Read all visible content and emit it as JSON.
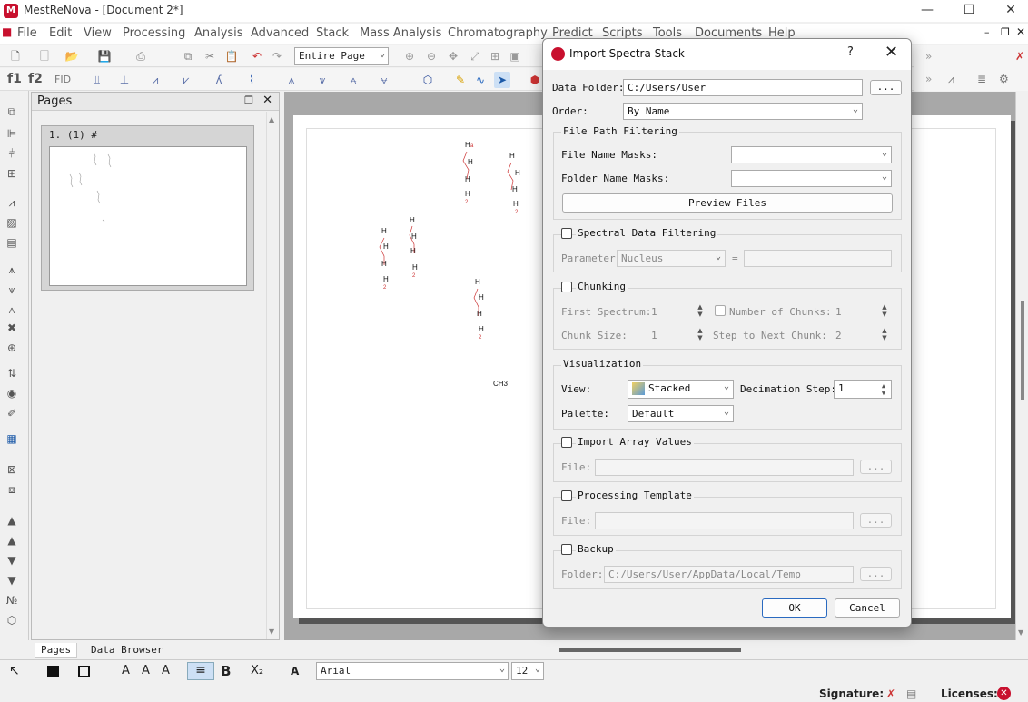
{
  "window": {
    "title": "MestReNova - [Document 2*]",
    "minimize": "—",
    "maximize": "☐",
    "close": "✕"
  },
  "menu": [
    "File",
    "Edit",
    "View",
    "Processing",
    "Analysis",
    "Advanced",
    "Stack",
    "Mass Analysis",
    "Chromatography",
    "Predict",
    "Scripts",
    "Tools",
    "Documents",
    "Help"
  ],
  "toolbar": {
    "page_mode": "Entire Page",
    "f1": "f1",
    "f2": "f2",
    "fid": "FID"
  },
  "pages_panel": {
    "title": "Pages",
    "item_label": "1.  (1)  #"
  },
  "bottom_tabs": {
    "pages": "Pages",
    "data_browser": "Data Browser"
  },
  "format_bar": {
    "font": "Arial",
    "size": "12"
  },
  "status": {
    "signature": "Signature:",
    "licenses": "Licenses:"
  },
  "document": {
    "ch3": "CH3"
  },
  "dialog": {
    "title": "Import Spectra Stack",
    "help": "?",
    "close": "✕",
    "data_folder_label": "Data Folder:",
    "data_folder_value": "C:/Users/User",
    "browse": "...",
    "order_label": "Order:",
    "order_value": "By Name",
    "file_path_filtering": "File Path Filtering",
    "file_name_masks_label": "File Name Masks:",
    "folder_name_masks_label": "Folder Name Masks:",
    "preview_files": "Preview Files",
    "spectral_filtering": "Spectral Data Filtering",
    "parameter_label": "Parameter",
    "parameter_value": "Nucleus",
    "equals": "=",
    "chunking": "Chunking",
    "first_spectrum_label": "First Spectrum:",
    "first_spectrum_value": "1",
    "number_of_chunks_label": "Number of Chunks:",
    "number_of_chunks_value": "1",
    "chunk_size_label": "Chunk Size:",
    "chunk_size_value": "1",
    "step_label": "Step to Next Chunk:",
    "step_value": "2",
    "visualization": "Visualization",
    "view_label": "View:",
    "view_value": "Stacked",
    "decimation_label": "Decimation Step:",
    "decimation_value": "1",
    "palette_label": "Palette:",
    "palette_value": "Default",
    "import_array": "Import Array Values",
    "file_label": "File:",
    "processing_template": "Processing Template",
    "backup": "Backup",
    "folder_label": "Folder:",
    "backup_folder": "C:/Users/User/AppData/Local/Temp",
    "ok": "OK",
    "cancel": "Cancel"
  }
}
